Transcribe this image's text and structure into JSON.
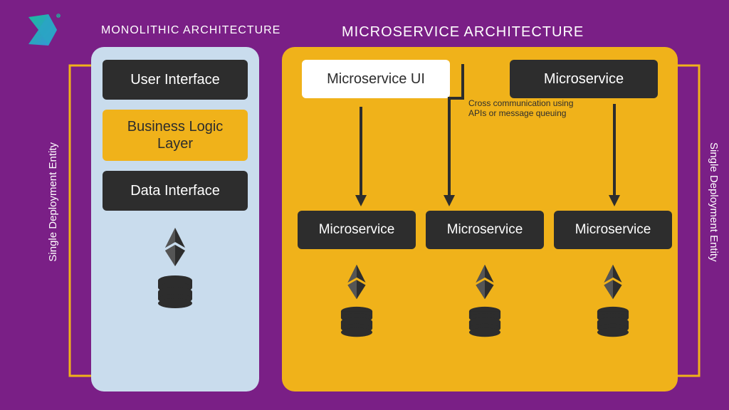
{
  "logo_name": "D logo",
  "titles": {
    "monolithic": "MONOLITHIC ARCHITECTURE",
    "microservice": "MICROSERVICE ARCHITECTURE"
  },
  "monolithic": {
    "ui": "User Interface",
    "logic": "Business Logic\nLayer",
    "data": "Data Interface"
  },
  "micro": {
    "top_left": "Microservice UI",
    "top_right": "Microservice",
    "note": "Cross communication using APIs or message queuing",
    "bottom": [
      "Microservice",
      "Microservice",
      "Microservice"
    ]
  },
  "labels": {
    "left": "Single Deployment Entity",
    "right": "Single Deployment Entity"
  },
  "colors": {
    "bg": "#7a1f86",
    "yellow": "#f0b21a",
    "dark": "#2d2d2d",
    "light": "#c9dced"
  }
}
